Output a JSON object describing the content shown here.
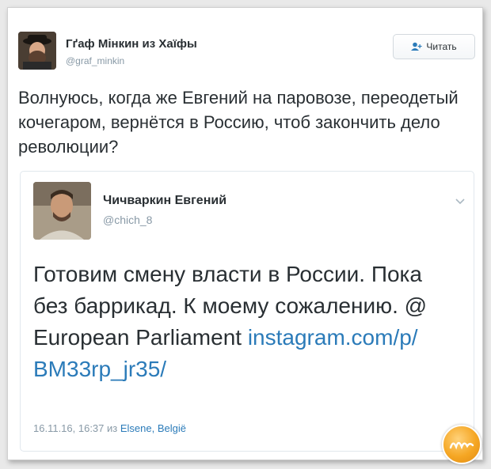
{
  "tweet": {
    "author_name": "Гґаф Мінкин из Хаїфы",
    "author_handle": "@graf_minkin",
    "follow_label": "Читать",
    "text": "Волнуюсь, когда же Евгений на паровозе, переодетый кочегаром, вернётся в Россию, чтоб закончить дело революции?"
  },
  "quoted": {
    "author_name": "Чичваркин Евгений",
    "author_handle": "@chich_8",
    "text_plain": "Готовим смену власти в России. Пока без баррикад. К моему сожалению. @ European Parliament ",
    "link_text": "instagram.com/p/ BM33rp_jr35/",
    "timestamp": "16.11.16, 16:37 из ",
    "location": "Elsene, België"
  },
  "icons": {
    "follow": "add-user-icon",
    "menu": "chevron-down-icon",
    "watermark": "watermark-logo"
  },
  "colors": {
    "link": "#2b7bb9",
    "text": "#292f33",
    "muted": "#8899a6",
    "watermark": "#f5a623"
  }
}
